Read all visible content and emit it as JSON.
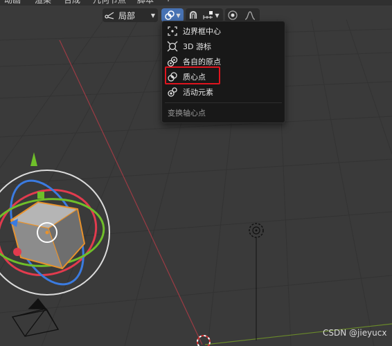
{
  "top_menu": {
    "items": [
      "动画",
      "渲染",
      "合成",
      "几何节点",
      "脚本",
      "+"
    ]
  },
  "header": {
    "orientation_label": "局部",
    "orientation_icon": "transform-orientation-icon",
    "pivot_icon": "pivot-median-icon",
    "snap_icon": "snap-icon",
    "snap_target_icon": "snap-increment-icon",
    "proportional_icon": "proportional-edit-icon",
    "falloff_icon": "falloff-curve-icon",
    "accent_color": "#4772b3"
  },
  "pivot_menu": {
    "items": [
      {
        "label": "边界框中心",
        "icon": "bounding-box-center-icon"
      },
      {
        "label": "3D 游标",
        "icon": "3d-cursor-icon"
      },
      {
        "label": "各自的原点",
        "icon": "individual-origins-icon"
      },
      {
        "label": "质心点",
        "icon": "median-point-icon",
        "highlighted": true
      },
      {
        "label": "活动元素",
        "icon": "active-element-icon"
      }
    ],
    "title": "变换轴心点",
    "highlight_color": "#e0141e"
  },
  "viewport": {
    "background": "#3a3a3a",
    "x_axis_color": "#9b3b44",
    "y_axis_color": "#6a8a2a",
    "object_outline_color": "#e8922c",
    "gizmo_colors": {
      "x": "#e23b4e",
      "y": "#6fbf2a",
      "z": "#3b7be0"
    }
  },
  "watermark": "CSDN @jieyucx"
}
